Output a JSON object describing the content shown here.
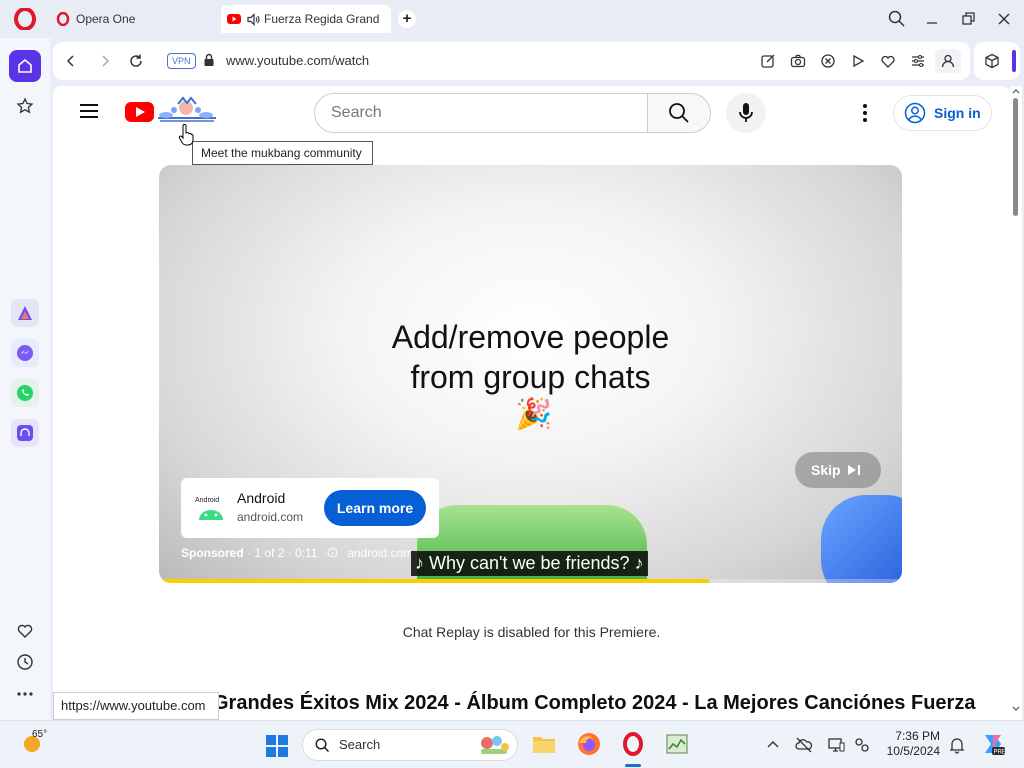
{
  "browser": {
    "tabs": [
      {
        "label": "Opera One"
      },
      {
        "label": "Fuerza Regida Grande"
      }
    ],
    "address": {
      "vpn_label": "VPN",
      "url": "www.youtube.com/watch"
    }
  },
  "youtube": {
    "search_placeholder": "Search",
    "sign_in_label": "Sign in",
    "doodle_tooltip": "Meet the mukbang community",
    "ad": {
      "headline_line1": "Add/remove people",
      "headline_line2": "from group chats",
      "emoji": "🎉",
      "advertiser_name": "Android",
      "advertiser_domain": "android.com",
      "learn_more_label": "Learn more",
      "skip_label": "Skip",
      "sponsored_label": "Sponsored",
      "ad_position": "· 1 of 2 · 0:11",
      "ad_domain": "android.com",
      "caption": "♪ Why can't we be friends? ♪",
      "progress_fraction": 0.74
    },
    "chat_note": "Chat Replay is disabled for this Premiere.",
    "video_title": "Grandes Éxitos Mix 2024 - Álbum Completo 2024 - La Mejores Canciónes Fuerza"
  },
  "status_url": "https://www.youtube.com",
  "taskbar": {
    "temperature": "65°",
    "search_placeholder": "Search",
    "time": "7:36 PM",
    "date": "10/5/2024"
  },
  "colors": {
    "opera_accent": "#5b34e8",
    "youtube_red": "#ff0000",
    "link_blue": "#065fd4"
  }
}
